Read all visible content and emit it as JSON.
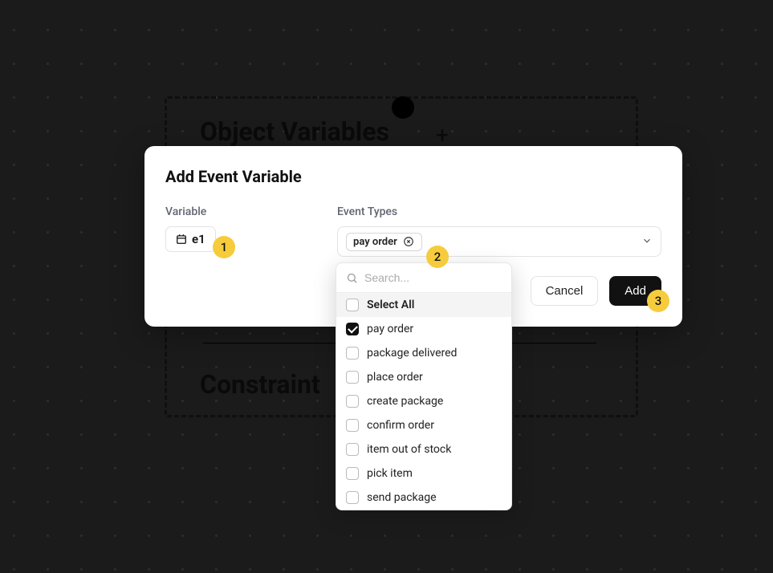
{
  "panel": {
    "object_variables_title": "Object Variables",
    "constraints_title": "Constraint",
    "plus": "+"
  },
  "modal": {
    "title": "Add Event Variable",
    "variable_label": "Variable",
    "event_types_label": "Event Types",
    "variable_chip": "e1",
    "selected_tag": "pay order",
    "cancel": "Cancel",
    "add": "Add"
  },
  "dropdown": {
    "search_placeholder": "Search...",
    "select_all": "Select All",
    "options": [
      {
        "label": "pay order",
        "checked": true
      },
      {
        "label": "package delivered",
        "checked": false
      },
      {
        "label": "place order",
        "checked": false
      },
      {
        "label": "create package",
        "checked": false
      },
      {
        "label": "confirm order",
        "checked": false
      },
      {
        "label": "item out of stock",
        "checked": false
      },
      {
        "label": "pick item",
        "checked": false
      },
      {
        "label": "send package",
        "checked": false
      }
    ]
  },
  "badges": {
    "b1": "1",
    "b2": "2",
    "b3": "3"
  }
}
